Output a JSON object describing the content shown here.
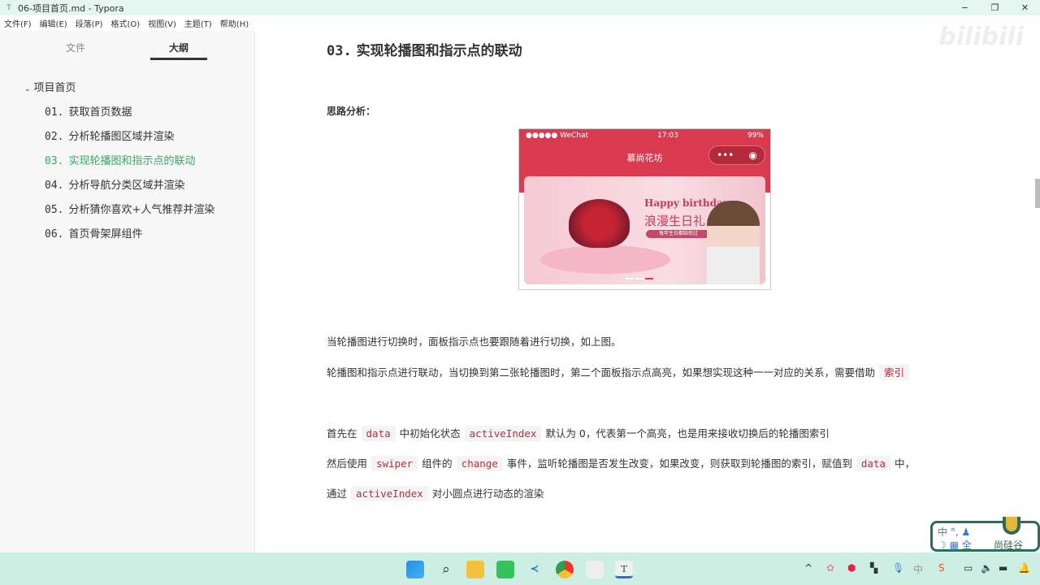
{
  "window": {
    "title": "06-项目首页.md - Typora",
    "app_icon": "T",
    "minimize": "−",
    "maximize": "❐",
    "close": "✕"
  },
  "menu": [
    "文件(F)",
    "编辑(E)",
    "段落(P)",
    "格式(O)",
    "视图(V)",
    "主题(T)",
    "帮助(H)"
  ],
  "sidebar": {
    "tabs": [
      "文件",
      "大纲"
    ],
    "active_tab": "大纲",
    "outline": [
      {
        "label": "项目首页",
        "level": 1
      },
      {
        "num": "01.",
        "label": "获取首页数据"
      },
      {
        "num": "02.",
        "label": "分析轮播图区域并渲染"
      },
      {
        "num": "03.",
        "label": "实现轮播图和指示点的联动",
        "active": true
      },
      {
        "num": "04.",
        "label": "分析导航分类区域并渲染"
      },
      {
        "num": "05.",
        "label": "分析猜你喜欢+人气推荐并渲染"
      },
      {
        "num": "06.",
        "label": "首页骨架屏组件"
      }
    ],
    "footer": {
      "collapse": "<",
      "source": "</>"
    }
  },
  "doc": {
    "heading_num": "03.",
    "heading": "实现轮播图和指示点的联动",
    "sub": "思路分析：",
    "phone": {
      "signal": "●●●●● WeChat",
      "time": "17:03",
      "battery": "99%",
      "title": "慕尚花坊",
      "menu": "•••",
      "banner_en": "Happy birthday",
      "banner_cn": "浪漫生日礼",
      "banner_tag": "每年生日都陪你过"
    },
    "p1": "当轮播图进行切换时，面板指示点也要跟随着进行切换，如上图。",
    "p2": "轮播图和指示点进行联动，当切换到第二张轮播图时，第二个面板指示点高亮，如果想实现这种一一对应的关系，需要借助",
    "p2_code": "索引",
    "p3": [
      "首先在",
      "data",
      "中初始化状态",
      "activeIndex",
      "默认为 0，代表第一个高亮，也是用来接收切换后的轮播图索引"
    ],
    "p4": [
      "然后使用",
      "swiper",
      "组件的",
      "change",
      "事件，监听轮播图是否发生改变，如果改变，则获取到轮播图的索引，赋值到",
      "data",
      "中，"
    ],
    "p5": [
      "通过",
      "activeIndex",
      "对小圆点进行动态的渲染"
    ]
  },
  "watermark": "bilibili",
  "ime": {
    "line1": "中 °, ♟",
    "line2": "☽ ▦ 全",
    "brand": "尚硅谷"
  },
  "taskbar": {
    "apps": [
      "windows-start",
      "search",
      "file-explorer",
      "wechat-tools",
      "vscode",
      "chrome",
      "other-app",
      "typora"
    ],
    "typora_label": "T"
  }
}
